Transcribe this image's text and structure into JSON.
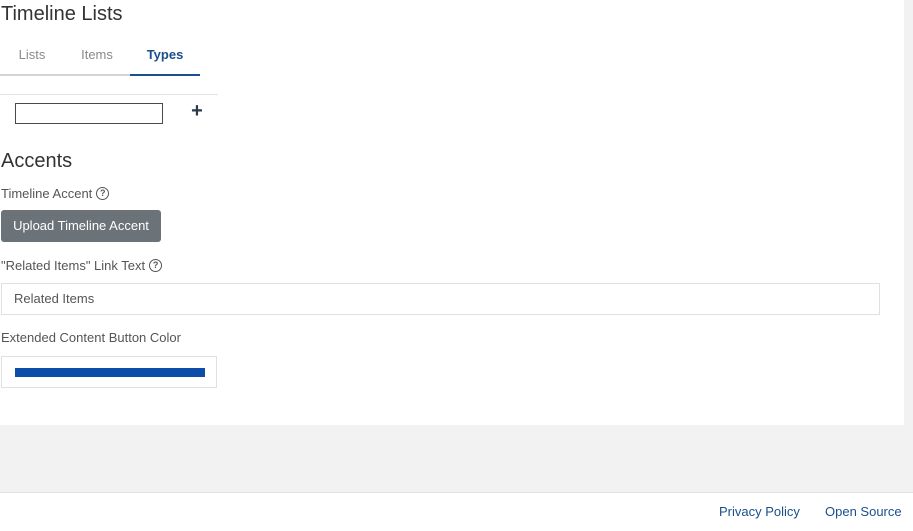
{
  "header": {
    "title": "Timeline Lists"
  },
  "tabs": [
    {
      "label": "Lists",
      "active": false
    },
    {
      "label": "Items",
      "active": false
    },
    {
      "label": "Types",
      "active": true
    }
  ],
  "types": {
    "input_value": "",
    "add_icon": "plus-icon"
  },
  "accents": {
    "heading": "Accents",
    "timeline_accent_label": "Timeline Accent",
    "upload_button_label": "Upload Timeline Accent",
    "related_items_label": "\"Related Items\" Link Text",
    "related_items_value": "Related Items",
    "extended_button_color_label": "Extended Content Button Color",
    "extended_button_color": "#0b4da8",
    "help_icon": "help-icon"
  },
  "footer": {
    "privacy_policy": "Privacy Policy",
    "open_source": "Open Source"
  },
  "colors": {
    "accent": "#1a4f8b",
    "button_bg": "#6b7378"
  }
}
